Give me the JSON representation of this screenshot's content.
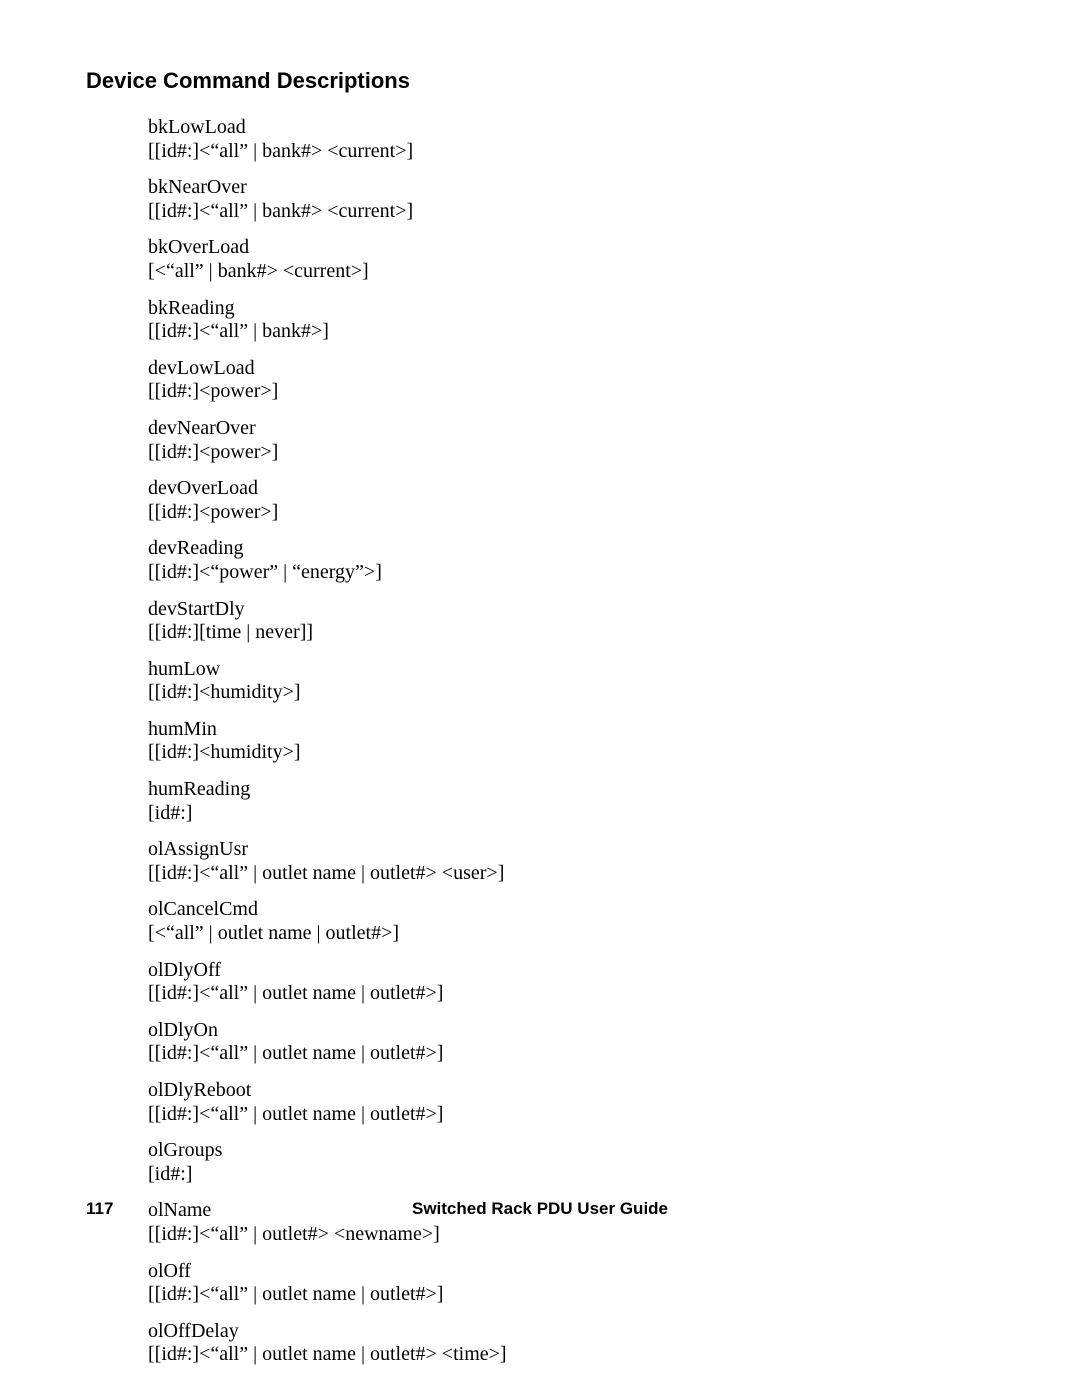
{
  "heading": "Device Command Descriptions",
  "commands": [
    {
      "name": "bkLowLoad",
      "args": "[[id#:]<“all” | bank#> <current>]"
    },
    {
      "name": "bkNearOver",
      "args": "[[id#:]<“all” | bank#> <current>]"
    },
    {
      "name": "bkOverLoad",
      "args": "[<“all” | bank#> <current>]"
    },
    {
      "name": "bkReading",
      "args": "[[id#:]<“all” | bank#>]"
    },
    {
      "name": "devLowLoad",
      "args": "[[id#:]<power>]"
    },
    {
      "name": "devNearOver",
      "args": "[[id#:]<power>]"
    },
    {
      "name": "devOverLoad",
      "args": "[[id#:]<power>]"
    },
    {
      "name": "devReading",
      "args": "[[id#:]<“power” | “energy”>]"
    },
    {
      "name": "devStartDly",
      "args": "[[id#:][time | never]]"
    },
    {
      "name": "humLow",
      "args": "[[id#:]<humidity>]"
    },
    {
      "name": "humMin",
      "args": "[[id#:]<humidity>]"
    },
    {
      "name": "humReading",
      "args": "[id#:]"
    },
    {
      "name": "olAssignUsr",
      "args": "[[id#:]<“all” | outlet name | outlet#> <user>]"
    },
    {
      "name": "olCancelCmd",
      "args": "[<“all” | outlet name | outlet#>]"
    },
    {
      "name": "olDlyOff",
      "args": "[[id#:]<“all” | outlet name | outlet#>]"
    },
    {
      "name": "olDlyOn",
      "args": "[[id#:]<“all” | outlet name | outlet#>]"
    },
    {
      "name": "olDlyReboot",
      "args": "[[id#:]<“all” | outlet name | outlet#>]"
    },
    {
      "name": "olGroups",
      "args": "[id#:]"
    },
    {
      "name": "olName",
      "args": "[[id#:]<“all” | outlet#> <newname>]"
    },
    {
      "name": "olOff",
      "args": "[[id#:]<“all” | outlet name | outlet#>]"
    },
    {
      "name": "olOffDelay",
      "args": "[[id#:]<“all” | outlet name | outlet#> <time>]"
    }
  ],
  "footer": {
    "page_number": "117",
    "title": "Switched Rack PDU User Guide"
  }
}
